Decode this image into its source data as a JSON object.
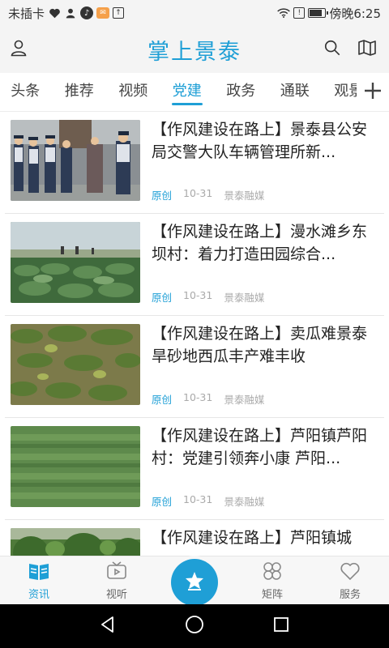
{
  "status_bar": {
    "carrier": "未插卡",
    "time_text": "傍晚6:25",
    "battery_level": 0.85
  },
  "header": {
    "title": "掌上景泰",
    "icons": [
      "user-icon",
      "search-icon",
      "map-icon"
    ]
  },
  "tabs": {
    "items": [
      "头条",
      "推荐",
      "视频",
      "党建",
      "政务",
      "通联",
      "观景"
    ],
    "active": "党建",
    "add_icon": "plus-icon"
  },
  "news": [
    {
      "title": "【作风建设在路上】景泰县公安局交警大队车辆管理所新...",
      "tag": "原创",
      "date": "10-31",
      "source": "景泰融媒",
      "thumb": "police-officers-photo"
    },
    {
      "title": "【作风建设在路上】漫水滩乡东坝村：着力打造田园综合...",
      "tag": "原创",
      "date": "10-31",
      "source": "景泰融媒",
      "thumb": "field-workers-photo"
    },
    {
      "title": "【作风建设在路上】卖瓜难景泰旱砂地西瓜丰产难丰收",
      "tag": "原创",
      "date": "10-31",
      "source": "景泰融媒",
      "thumb": "watermelon-field-photo"
    },
    {
      "title": "【作风建设在路上】芦阳镇芦阳村：党建引领奔小康 芦阳...",
      "tag": "原创",
      "date": "10-31",
      "source": "景泰融媒",
      "thumb": "green-field-photo"
    },
    {
      "title": "【作风建设在路上】芦阳镇城",
      "tag": "",
      "date": "",
      "source": "",
      "thumb": "trees-photo"
    }
  ],
  "bottom_nav": {
    "items": [
      {
        "label": "资讯",
        "icon": "news-book-icon",
        "active": true
      },
      {
        "label": "视听",
        "icon": "tv-icon",
        "active": false
      },
      {
        "label": "矩阵",
        "icon": "matrix-icon",
        "active": false
      },
      {
        "label": "服务",
        "icon": "heart-icon",
        "active": false
      }
    ],
    "center_icon": "star-home-icon"
  },
  "colors": {
    "accent": "#1f9fd6",
    "tag": "#1f9fd6",
    "meta": "#aaaaaa"
  }
}
